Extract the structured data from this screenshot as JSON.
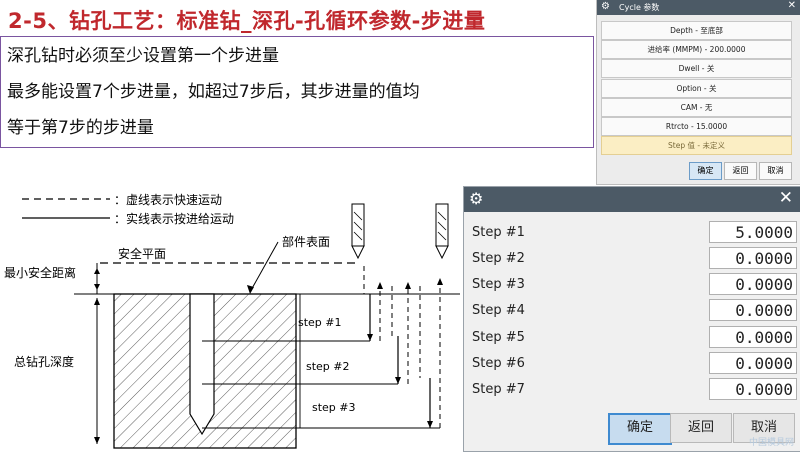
{
  "title": "2-5、钻孔工艺：标准钻_深孔-孔循环参数-步进量",
  "description": {
    "lines": [
      "深孔钻时必须至少设置第一个步进量",
      "最多能设置7个步进量，如超过7步后，其步进量的值均",
      "等于第7步的步进量"
    ]
  },
  "cycle_dialog": {
    "title": "Cycle 参数",
    "buttons": [
      "Depth - 至底部",
      "进给率 (MMPM) - 200.0000",
      "Dwell - 关",
      "Option - 关",
      "CAM - 无",
      "Rtrcto - 15.0000",
      "Step 值 - 未定义"
    ],
    "footer": {
      "ok": "确定",
      "back": "返回",
      "cancel": "取消"
    }
  },
  "step_dialog": {
    "steps": [
      {
        "label": "Step #1",
        "value": "5.0000"
      },
      {
        "label": "Step #2",
        "value": "0.0000"
      },
      {
        "label": "Step #3",
        "value": "0.0000"
      },
      {
        "label": "Step #4",
        "value": "0.0000"
      },
      {
        "label": "Step #5",
        "value": "0.0000"
      },
      {
        "label": "Step #6",
        "value": "0.0000"
      },
      {
        "label": "Step #7",
        "value": "0.0000"
      }
    ],
    "footer": {
      "ok": "确定",
      "back": "返回",
      "cancel": "取消"
    }
  },
  "diagram": {
    "legend_dashed": "：虚线表示快速运动",
    "legend_solid": "：实线表示按进给运动",
    "safe_plane": "安全平面",
    "part_surface": "部件表面",
    "min_clearance": "最小安全距离",
    "total_depth": "总钻孔深度",
    "step1": "step #1",
    "step2": "step #2",
    "step3": "step #3"
  },
  "watermark": "中国模具网"
}
